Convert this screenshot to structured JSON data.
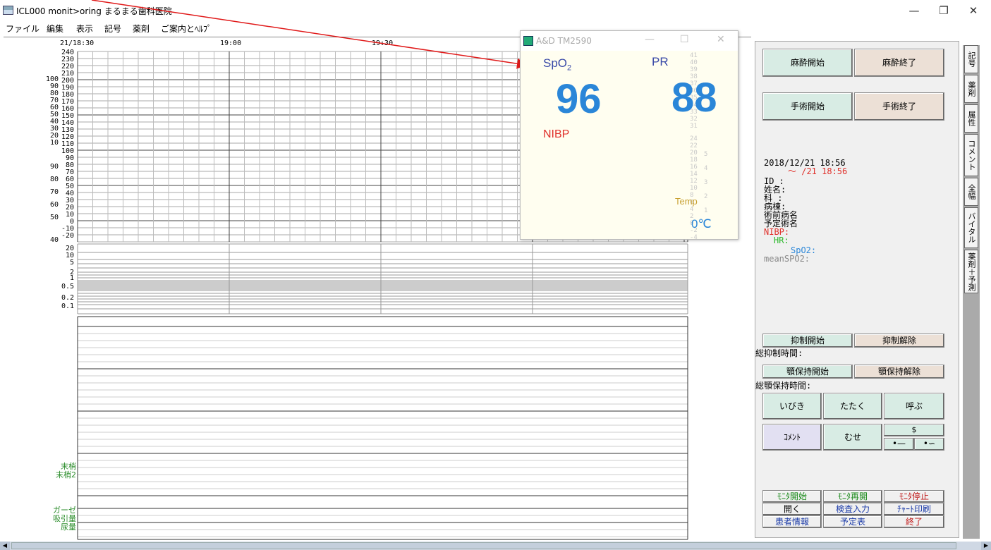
{
  "window": {
    "title": "ICL000 monit>oring まるまる歯科医院",
    "controls": {
      "minimize": "—",
      "maximize": "❐",
      "close": "✕"
    }
  },
  "menu": [
    "ファイル",
    "編集",
    "表示",
    "記号",
    "薬剤",
    "ご案内とﾍﾙﾌﾟ"
  ],
  "chart": {
    "times": [
      "21/18:30",
      "19:00",
      "19:30"
    ],
    "right_scale_fragment": "20:30",
    "upper_scale_left": [
      "100",
      "90",
      "80",
      "70",
      "60",
      "50",
      "40",
      "30",
      "20",
      "10",
      "",
      "90",
      "80",
      "70",
      "60",
      "50",
      "40"
    ],
    "upper_scale_right": [
      "240",
      "230",
      "220",
      "210",
      "200",
      "190",
      "180",
      "170",
      "160",
      "150",
      "140",
      "130",
      "120",
      "110",
      "100",
      "90",
      "80",
      "70",
      "60",
      "50",
      "40",
      "30",
      "20",
      "10",
      "0",
      "-10",
      "-20"
    ],
    "lower_scale": [
      "20",
      "10",
      "5",
      "2",
      "1",
      "0.5",
      "0.2",
      "0.1"
    ],
    "green_labels": [
      "末梢",
      "末梢2",
      "ガーゼ",
      "吸引量",
      "尿量"
    ]
  },
  "monitor_window": {
    "title": "A&D TM2590",
    "spo2_label": "SpO",
    "spo2_sub": "2",
    "pr_label": "PR",
    "spo2_value": "96",
    "pr_value": "88",
    "nibp_label": "NIBP",
    "temp_label": "Temp",
    "temp_value": "0℃",
    "scale_values": [
      "41",
      "40",
      "39",
      "38",
      "37",
      "36",
      "35",
      "34",
      "33",
      "32",
      "31",
      "24",
      "22",
      "20",
      "18",
      "16",
      "14",
      "12",
      "10",
      "8",
      "6",
      "4",
      "2",
      "0",
      "-2",
      "-4"
    ],
    "scale_right": [
      "5",
      "4",
      "3",
      "2",
      "1"
    ],
    "colors": {
      "value": "#2a86d8",
      "nibp": "#e0302a",
      "temp": "#c8a030",
      "label": "#3a4aa8"
    }
  },
  "right_panel": {
    "anesthesia_start": "麻酔開始",
    "anesthesia_end": "麻酔終了",
    "surgery_start": "手術開始",
    "surgery_end": "手術終了",
    "date_start": "2018/12/21 18:56",
    "date_end": "〜 /21 18:56",
    "fields": [
      "ID  :",
      "姓名:",
      "科  :",
      "病棟:",
      "術前病名",
      "予定術名"
    ],
    "nibp": "NIBP:",
    "hr": "HR:",
    "spo2": "SpO2:",
    "mean_spo2": "meanSPO2:",
    "suppression_start": "抑制開始",
    "suppression_release": "抑制解除",
    "total_suppression": "総抑制時間:",
    "jaw_hold_start": "顎保持開始",
    "jaw_hold_release": "顎保持解除",
    "total_jaw_hold": "総顎保持時間:",
    "ibiki": "いびき",
    "tataku": "たたく",
    "yobu": "呼ぶ",
    "comment": "ｺﾒﾝﾄ",
    "muse": "むせ",
    "monitor_start": "ﾓﾆﾀ開始",
    "monitor_resume": "ﾓﾆﾀ再開",
    "monitor_stop": "ﾓﾆﾀ停止",
    "open": "開く",
    "test_input": "検査入力",
    "chart_print": "ﾁｬｰﾄ印刷",
    "patient_info": "患者情報",
    "schedule": "予定表",
    "exit": "終了"
  },
  "side_tabs": [
    "記号",
    "薬剤",
    "属性",
    "コメント",
    "全幅",
    "バイタル",
    "薬剤＋予測"
  ]
}
